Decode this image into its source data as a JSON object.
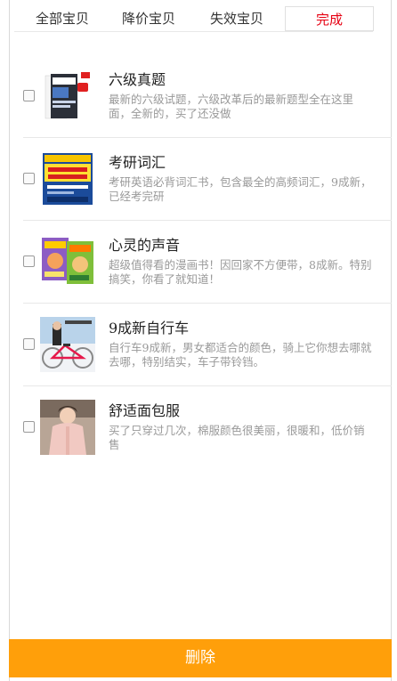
{
  "tabs": {
    "all": "全部宝贝",
    "price_drop": "降价宝贝",
    "invalid": "失效宝贝",
    "done": "完成"
  },
  "items": [
    {
      "title": "六级真题",
      "desc": "最新的六级试题，六级改革后的最新题型全在这里面，全新的，买了还没做",
      "checked": false
    },
    {
      "title": "考研词汇",
      "desc": "考研英语必背词汇书，包含最全的高频词汇，9成新，已经考完研",
      "checked": false
    },
    {
      "title": "心灵的声音",
      "desc": "超级值得看的漫画书！因回家不方便带，8成新。特别搞笑，你看了就知道！",
      "checked": false
    },
    {
      "title": "9成新自行车",
      "desc": "自行车9成新，男女都适合的颜色，骑上它你想去哪就去哪，特别结实，车子带铃铛。",
      "checked": false
    },
    {
      "title": "舒适面包服",
      "desc": "买了只穿过几次，棉服颜色很美丽，很暖和，低价销售",
      "checked": false
    }
  ],
  "delete_label": "删除",
  "colors": {
    "accent": "#ff9f0a",
    "active_tab": "#e60012"
  }
}
